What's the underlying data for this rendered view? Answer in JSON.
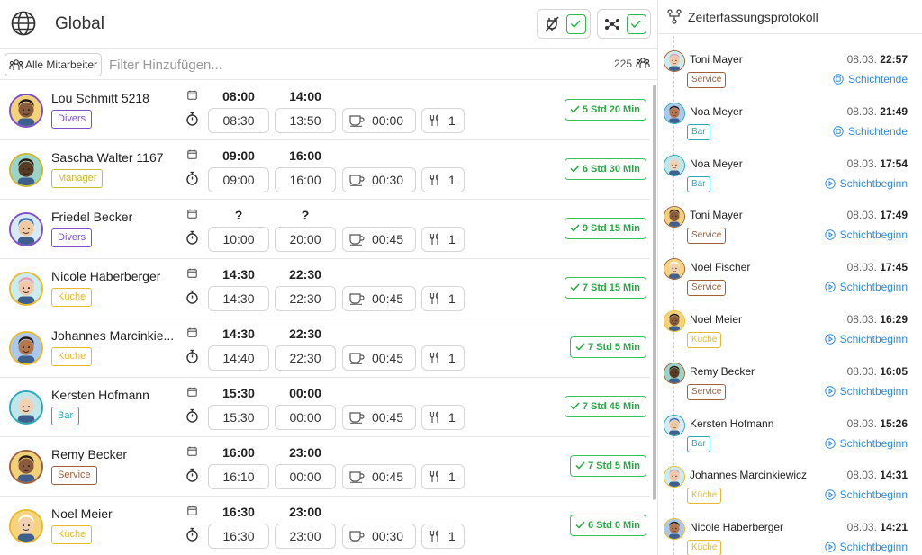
{
  "header": {
    "title": "Global",
    "globe_icon": "globe-icon"
  },
  "toolbar": {
    "buttons": [
      {
        "icon": "no-plug-icon",
        "check": "check-icon"
      },
      {
        "icon": "org-tree-icon",
        "check": "check-icon"
      }
    ]
  },
  "filter": {
    "employees_label": "Alle Mitarbeiter",
    "placeholder": "Filter Hinzufügen...",
    "count": "225"
  },
  "colors": {
    "divers": "#7d4fc9",
    "manager": "#c9b92e",
    "kueche": "#e8b92a",
    "bar": "#2aa8b5",
    "service": "#a0603a",
    "success": "#2aa845",
    "link": "#2e8be6"
  },
  "rows": [
    {
      "name": "Lou Schmitt 5218",
      "role": "Divers",
      "plan_start": "08:00",
      "plan_end": "14:00",
      "act_start": "08:30",
      "act_end": "13:50",
      "break": "00:00",
      "meals": "1",
      "duration": "5 Std 20 Min"
    },
    {
      "name": "Sascha Walter 1167",
      "role": "Manager",
      "plan_start": "09:00",
      "plan_end": "16:00",
      "act_start": "09:00",
      "act_end": "16:00",
      "break": "00:30",
      "meals": "1",
      "duration": "6 Std 30 Min"
    },
    {
      "name": "Friedel Becker",
      "role": "Divers",
      "plan_start": "?",
      "plan_end": "?",
      "act_start": "10:00",
      "act_end": "20:00",
      "break": "00:45",
      "meals": "1",
      "duration": "9 Std 15 Min"
    },
    {
      "name": "Nicole Haberberger",
      "role": "Küche",
      "plan_start": "14:30",
      "plan_end": "22:30",
      "act_start": "14:30",
      "act_end": "22:30",
      "break": "00:45",
      "meals": "1",
      "duration": "7 Std 15 Min"
    },
    {
      "name": "Johannes Marcinkie...",
      "role": "Küche",
      "plan_start": "14:30",
      "plan_end": "22:30",
      "act_start": "14:40",
      "act_end": "22:30",
      "break": "00:45",
      "meals": "1",
      "duration": "7 Std 5 Min"
    },
    {
      "name": "Kersten Hofmann",
      "role": "Bar",
      "plan_start": "15:30",
      "plan_end": "00:00",
      "act_start": "15:30",
      "act_end": "00:00",
      "break": "00:45",
      "meals": "1",
      "duration": "7 Std 45 Min"
    },
    {
      "name": "Remy Becker",
      "role": "Service",
      "plan_start": "16:00",
      "plan_end": "23:00",
      "act_start": "16:10",
      "act_end": "00:00",
      "break": "00:45",
      "meals": "1",
      "duration": "7 Std 5 Min"
    },
    {
      "name": "Noel Meier",
      "role": "Küche",
      "plan_start": "16:30",
      "plan_end": "23:00",
      "act_start": "16:30",
      "act_end": "23:00",
      "break": "00:30",
      "meals": "1",
      "duration": "6 Std 0 Min"
    }
  ],
  "log": {
    "title": "Zeiterfassungsprotokoll",
    "entries": [
      {
        "name": "Toni Mayer",
        "role": "Service",
        "date": "08.03.",
        "time": "22:57",
        "action": "Schichtende"
      },
      {
        "name": "Noa Meyer",
        "role": "Bar",
        "date": "08.03.",
        "time": "21:49",
        "action": "Schichtende"
      },
      {
        "name": "Noa Meyer",
        "role": "Bar",
        "date": "08.03.",
        "time": "17:54",
        "action": "Schichtbeginn"
      },
      {
        "name": "Toni Mayer",
        "role": "Service",
        "date": "08.03.",
        "time": "17:49",
        "action": "Schichtbeginn"
      },
      {
        "name": "Noel Fischer",
        "role": "Service",
        "date": "08.03.",
        "time": "17:45",
        "action": "Schichtbeginn"
      },
      {
        "name": "Noel Meier",
        "role": "Küche",
        "date": "08.03.",
        "time": "16:29",
        "action": "Schichtbeginn"
      },
      {
        "name": "Remy Becker",
        "role": "Service",
        "date": "08.03.",
        "time": "16:05",
        "action": "Schichtbeginn"
      },
      {
        "name": "Kersten Hofmann",
        "role": "Bar",
        "date": "08.03.",
        "time": "15:26",
        "action": "Schichtbeginn"
      },
      {
        "name": "Johannes Marcinkiewicz",
        "role": "Küche",
        "date": "08.03.",
        "time": "14:31",
        "action": "Schichtbeginn"
      },
      {
        "name": "Nicole Haberberger",
        "role": "Küche",
        "date": "08.03.",
        "time": "14:21",
        "action": "Schichtbeginn"
      }
    ]
  }
}
